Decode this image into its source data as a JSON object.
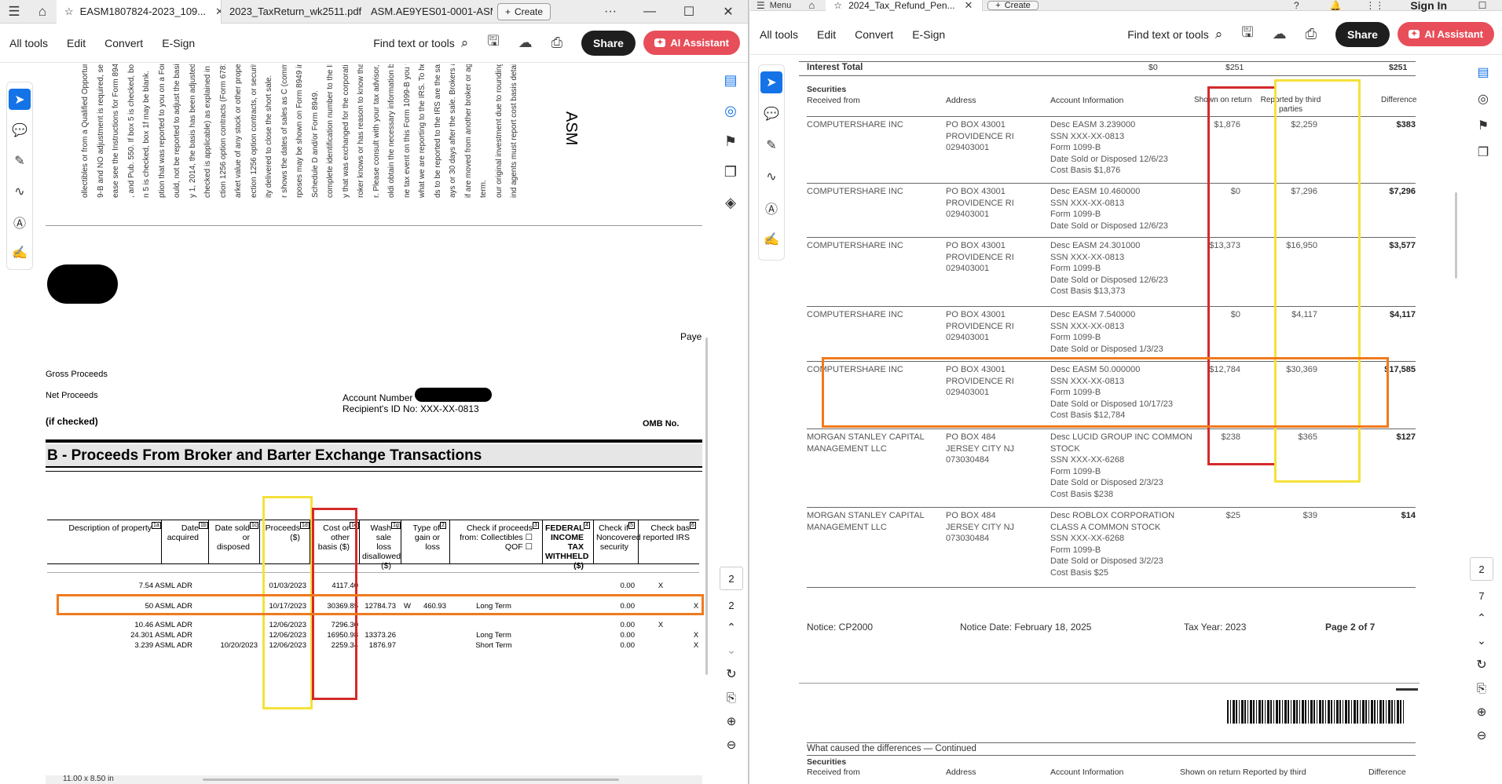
{
  "left_window": {
    "tabs": [
      {
        "label": "EASM1807824-2023_109..."
      },
      {
        "label": "2023_TaxReturn_wk2511.pdf"
      },
      {
        "label": "ASM.AE9YES01-0001-ASM-..."
      }
    ],
    "create_label": "Create",
    "menu": [
      "All tools",
      "Edit",
      "Convert",
      "E-Sign"
    ],
    "find_label": "Find text or tools",
    "share_label": "Share",
    "ai_label": "AI Assistant",
    "page_indicator": "2",
    "page_total": "2",
    "page_size": "11.00 x 8.50 in",
    "doc": {
      "rotated_lines": [
        "ind agents must report cost basis details.",
        "our original investment due to rounding.",
        "term.",
        "if are moved from another broker or agent",
        "ays or 30 days after the sale. Brokers and",
        "ds to be reported to the IRS are the same",
        "what we are reporting to the IRS. To help",
        "ne tax event on this Form 1099-B you will",
        "oldi obtain the necessary information by",
        "r. Please consult with your tax advisor, or",
        "roker knows or has reason to know that a",
        "y that was exchanged for the corporation's",
        "complete identification number to the IRS",
        "Schedule D and/or Form 8949.",
        "rposes may be shown on Form 8949 instead 1256",
        "r shows the dates of sales as C (common)",
        "ity delivered to close the short sale.",
        "ection 1256 option contracts, or securities",
        "arket value of any stock or other property",
        "ction 1256 option contracts (Form 6781,",
        "checked is applicable) as explained in the",
        "y 1, 2014, the basis has been adjusted to",
        "ould, not be reported to adjust the basis to",
        "ption that was reported to you on a Form",
        "n 5 is checked, box 1f may be blank.",
        ", and Pub. 550. If box 5 is checked, box",
        "ease see the Instructions for Form 8949,",
        "9-B and NO adjustment is required, see",
        "ollectibles or from a Qualified Opportunity"
      ],
      "asm_title": "ASM",
      "payers_fed": "Payer's Fe",
      "gross_proceeds": "Gross Proceeds",
      "net_proceeds": "Net Proceeds",
      "if_checked": "(if checked)",
      "account_number": "Account Number",
      "recipient_id": "Recipient's ID No: XXX-XX-0813",
      "omb": "OMB No.",
      "section_title": "B - Proceeds From Broker and Barter Exchange Transactions",
      "headers": [
        "Description of property",
        "Date acquired",
        "Date sold or disposed",
        "Proceeds ($)",
        "Cost or other basis ($)",
        "Wash sale loss disallowed ($)",
        "Type of gain or loss",
        "Check if proceeds from: Collectibles ☐ QOF ☐",
        "FEDERAL INCOME TAX WITHHELD ($)",
        "Check if Noncovered security",
        "Check bas reported IRS"
      ],
      "header_box_nums": [
        "1a",
        "1b",
        "1c",
        "1d",
        "1e",
        "1g",
        "2",
        "3",
        "4",
        "5",
        "6"
      ],
      "rows": [
        {
          "desc": "7.54 ASML ADR",
          "acq": "",
          "sold": "01/03/2023",
          "proceeds": "4117.40",
          "cost": "",
          "wash_code": "",
          "wash": "",
          "type": "",
          "fed": "0.00",
          "noncov": "X",
          "rep": ""
        },
        {
          "desc": "50 ASML ADR",
          "acq": "",
          "sold": "10/17/2023",
          "proceeds": "30369.85",
          "cost": "12784.73",
          "wash_code": "W",
          "wash": "460.93",
          "type": "Long Term",
          "fed": "0.00",
          "noncov": "",
          "rep": "X"
        },
        {
          "desc": "10.46 ASML ADR",
          "acq": "",
          "sold": "12/06/2023",
          "proceeds": "7296.30",
          "cost": "",
          "wash_code": "",
          "wash": "",
          "type": "",
          "fed": "0.00",
          "noncov": "X",
          "rep": ""
        },
        {
          "desc": "24.301 ASML ADR",
          "acq": "",
          "sold": "12/06/2023",
          "proceeds": "16950.98",
          "cost": "13373.26",
          "wash_code": "",
          "wash": "",
          "type": "Long Term",
          "fed": "0.00",
          "noncov": "",
          "rep": "X"
        },
        {
          "desc": "3.239 ASML ADR",
          "acq": "10/20/2023",
          "sold": "12/06/2023",
          "proceeds": "2259.34",
          "cost": "1876.97",
          "wash_code": "",
          "wash": "",
          "type": "Short Term",
          "fed": "0.00",
          "noncov": "",
          "rep": "X"
        }
      ]
    }
  },
  "right_window": {
    "menu_label": "Menu",
    "tab_label": "2024_Tax_Refund_Pen...",
    "create_label": "Create",
    "sign_in": "Sign In",
    "menu": [
      "All tools",
      "Edit",
      "Convert",
      "E-Sign"
    ],
    "find_label": "Find text or tools",
    "share_label": "Share",
    "ai_label": "AI Assistant",
    "page_indicator": "2",
    "page_total": "7",
    "doc": {
      "interest_total": {
        "label": "Interest Total",
        "shown": "$0",
        "reported": "$251",
        "diff": "$251"
      },
      "section": "Securities",
      "received_from": "Received from",
      "headers": {
        "address": "Address",
        "account": "Account Information",
        "shown": "Shown on return",
        "reported": "Reported by third parties",
        "difference": "Difference"
      },
      "rows": [
        {
          "from": [
            "COMPUTERSHARE INC"
          ],
          "address": [
            "PO BOX 43001",
            "PROVIDENCE RI",
            "029403001"
          ],
          "account": [
            "Desc EASM 3.239000",
            "SSN XXX-XX-0813",
            "Form 1099-B",
            "Date Sold or Disposed 12/6/23",
            "Cost Basis $1,876"
          ],
          "shown": "$1,876",
          "reported": "$2,259",
          "diff": "$383"
        },
        {
          "from": [
            "COMPUTERSHARE INC"
          ],
          "address": [
            "PO BOX 43001",
            "PROVIDENCE RI",
            "029403001"
          ],
          "account": [
            "Desc EASM 10.460000",
            "SSN XXX-XX-0813",
            "Form 1099-B",
            "Date Sold or Disposed 12/6/23"
          ],
          "shown": "$0",
          "reported": "$7,296",
          "diff": "$7,296"
        },
        {
          "from": [
            "COMPUTERSHARE INC"
          ],
          "address": [
            "PO BOX 43001",
            "PROVIDENCE RI",
            "029403001"
          ],
          "account": [
            "Desc EASM 24.301000",
            "SSN XXX-XX-0813",
            "Form 1099-B",
            "Date Sold or Disposed 12/6/23",
            "Cost Basis $13,373"
          ],
          "shown": "$13,373",
          "reported": "$16,950",
          "diff": "$3,577"
        },
        {
          "from": [
            "COMPUTERSHARE INC"
          ],
          "address": [
            "PO BOX 43001",
            "PROVIDENCE RI",
            "029403001"
          ],
          "account": [
            "Desc EASM 7.540000",
            "SSN XXX-XX-0813",
            "Form 1099-B",
            "Date Sold or Disposed 1/3/23"
          ],
          "shown": "$0",
          "reported": "$4,117",
          "diff": "$4,117"
        },
        {
          "from": [
            "COMPUTERSHARE INC"
          ],
          "address": [
            "PO BOX 43001",
            "PROVIDENCE RI",
            "029403001"
          ],
          "account": [
            "Desc EASM 50.000000",
            "SSN XXX-XX-0813",
            "Form 1099-B",
            "Date Sold or Disposed 10/17/23",
            "Cost Basis $12,784"
          ],
          "shown": "$12,784",
          "reported": "$30,369",
          "diff": "$17,585"
        },
        {
          "from": [
            "MORGAN STANLEY CAPITAL",
            "MANAGEMENT LLC"
          ],
          "address": [
            "PO BOX 484",
            "JERSEY CITY NJ",
            "073030484"
          ],
          "account": [
            "Desc LUCID GROUP INC COMMON",
            "STOCK",
            "SSN XXX-XX-6268",
            "Form 1099-B",
            "Date Sold or Disposed 2/3/23",
            "Cost Basis $238"
          ],
          "shown": "$238",
          "reported": "$365",
          "diff": "$127"
        },
        {
          "from": [
            "MORGAN STANLEY CAPITAL",
            "MANAGEMENT LLC"
          ],
          "address": [
            "PO BOX 484",
            "JERSEY CITY NJ",
            "073030484"
          ],
          "account": [
            "Desc ROBLOX CORPORATION",
            "CLASS A COMMON STOCK",
            "SSN XXX-XX-6268",
            "Form 1099-B",
            "Date Sold or Disposed 3/2/23",
            "Cost Basis $25"
          ],
          "shown": "$25",
          "reported": "$39",
          "diff": "$14"
        }
      ],
      "footer": {
        "notice": "Notice: CP2000",
        "notice_date": "Notice Date: February 18, 2025",
        "tax_year": "Tax Year: 2023",
        "page": "Page 2 of 7"
      },
      "continued": "What caused the differences — Continued",
      "continued_headers": {
        "section": "Securities",
        "received": "Received from",
        "address": "Address",
        "account": "Account Information",
        "shown": "Shown on return",
        "reported": "Reported by third",
        "difference": "Difference"
      }
    }
  },
  "colors": {
    "highlight_yellow": "#f5e13a",
    "highlight_red": "#d42a2a",
    "highlight_orange": "#f07a1e",
    "share_bg": "#1e1e1e",
    "ai_bg": "#e84e59",
    "tool_blue": "#1473e6"
  }
}
